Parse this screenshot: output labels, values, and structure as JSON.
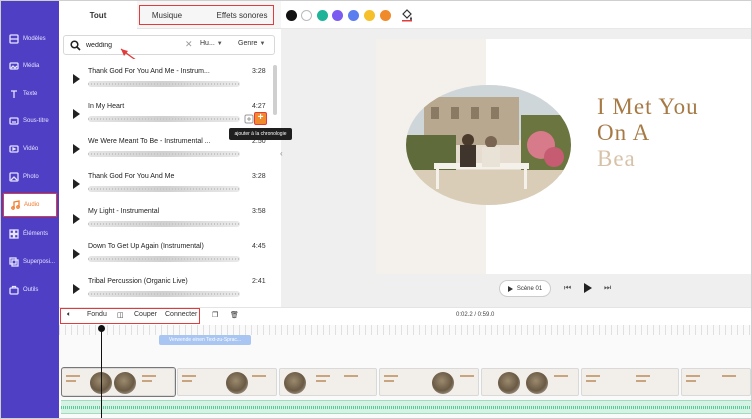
{
  "sidebar": {
    "items": [
      {
        "label": "Modèles",
        "icon": "templates-icon"
      },
      {
        "label": "Média",
        "icon": "media-icon"
      },
      {
        "label": "Texte",
        "icon": "text-icon"
      },
      {
        "label": "Sous-titre",
        "icon": "subtitle-icon"
      },
      {
        "label": "Vidéo",
        "icon": "video-icon"
      },
      {
        "label": "Photo",
        "icon": "photo-icon"
      },
      {
        "label": "Audio",
        "icon": "music-note-icon",
        "active": true
      },
      {
        "label": "Éléments",
        "icon": "elements-icon"
      },
      {
        "label": "Superposi...",
        "icon": "overlay-icon"
      },
      {
        "label": "Outils",
        "icon": "tools-icon"
      }
    ]
  },
  "tabs": {
    "all": "Tout",
    "music": "Musique",
    "sound_effects": "Effets sonores"
  },
  "toolbar": {
    "swatches": [
      "#111111",
      "#ffffff",
      "#1fb39a",
      "#7a5cf0",
      "#5a7df0",
      "#f5c02a",
      "#f08a2b"
    ]
  },
  "search": {
    "value": "wedding",
    "sort_label": "Hu...",
    "genre_label": "Genre"
  },
  "tracks": [
    {
      "title": "Thank God For You And Me - Instrum...",
      "duration": "3:28"
    },
    {
      "title": "In My Heart",
      "duration": "4:27"
    },
    {
      "title": "We Were Meant To Be - Instrumental ...",
      "duration": "2:50"
    },
    {
      "title": "Thank God For You And Me",
      "duration": "3:28"
    },
    {
      "title": "My Light - Instrumental",
      "duration": "3:58"
    },
    {
      "title": "Down To Get Up Again (Instrumental)",
      "duration": "4:45"
    },
    {
      "title": "Tribal Percussion (Organic Live)",
      "duration": "2:41"
    }
  ],
  "tooltip": "ajouter à la chronologie",
  "preview": {
    "headline_line1": "I Met You",
    "headline_line2": "On A",
    "headline_line3": "Bea",
    "scene_label": "Scène 01"
  },
  "timeline_toolbar": {
    "fade": "Fondu",
    "cut": "Couper",
    "connect": "Connecter",
    "time": "0:02.2 / 0:59.0"
  },
  "timeline": {
    "tts_chip": "Verwende einen Text-zu-Sprac..."
  }
}
